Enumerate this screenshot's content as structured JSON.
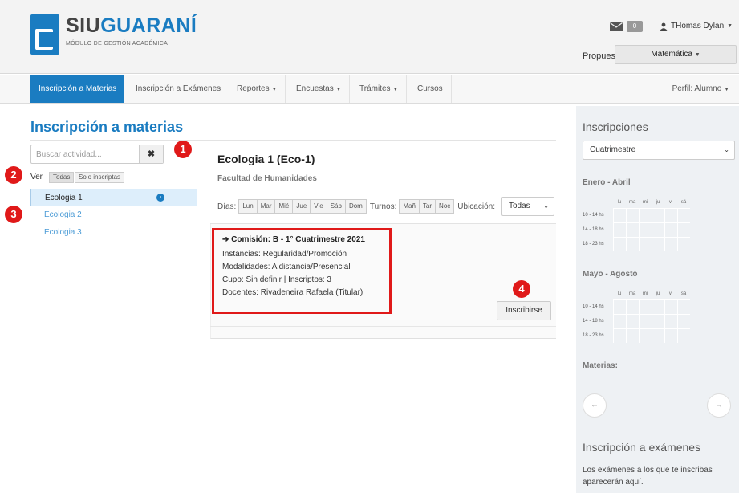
{
  "header": {
    "logo_siu": "SIU",
    "logo_guarani": "GUARANÍ",
    "logo_subtitle": "MÓDULO DE GESTIÓN ACADÉMICA",
    "mail_count": "0",
    "user_name": "THomas Dylan",
    "propuesta_label": "Propuesta:",
    "propuesta_value": "Matemática"
  },
  "nav": {
    "items": [
      {
        "label": "Inscripción a Materias",
        "active": true
      },
      {
        "label": "Inscripción a Exámenes"
      },
      {
        "label": "Reportes"
      },
      {
        "label": "Encuestas"
      },
      {
        "label": "Trámites"
      },
      {
        "label": "Cursos"
      }
    ],
    "perfil": "Perfil: Alumno"
  },
  "main": {
    "title": "Inscripción a materias",
    "search_placeholder": "Buscar actividad...",
    "clear_symbol": "✖",
    "ver_label": "Ver",
    "ver_options": [
      "Todas",
      "Solo inscriptas"
    ],
    "activities": [
      "Ecologia 1",
      "Ecologia 2",
      "Ecologia 3"
    ],
    "markers": [
      "1",
      "2",
      "3",
      "4"
    ]
  },
  "materia": {
    "title": "Ecologia 1 (Eco-1)",
    "facultad": "Facultad de Humanidades",
    "dias_label": "Días:",
    "dias": [
      "Lun",
      "Mar",
      "Mié",
      "Jue",
      "Vie",
      "Sáb",
      "Dom"
    ],
    "turnos_label": "Turnos:",
    "turnos": [
      "Mañ",
      "Tar",
      "Noc"
    ],
    "ubicacion_label": "Ubicación:",
    "ubicacion_value": "Todas",
    "commission": {
      "title": "➔ Comisión: B - 1° Cuatrimestre 2021",
      "instancias": "Instancias: Regularidad/Promoción",
      "modalidades": "Modalidades: A distancia/Presencial",
      "cupo": "Cupo: Sin definir | Inscriptos: 3",
      "docentes": "Docentes: Rivadeneira Rafaela (Titular)"
    },
    "inscribirse_label": "Inscribirse"
  },
  "sidebar": {
    "inscripciones_title": "Inscripciones",
    "periodo_value": "Cuatrimestre",
    "sem1_title": "Enero - Abril",
    "sem2_title": "Mayo - Agosto",
    "days": [
      "lu",
      "ma",
      "mi",
      "ju",
      "vi",
      "sá"
    ],
    "slots": [
      "10 - 14 hs",
      "14 - 18 hs",
      "18 - 23 hs"
    ],
    "materias_label": "Materias:",
    "prev_symbol": "←",
    "next_symbol": "→",
    "examenes_title": "Inscripción a exámenes",
    "examenes_text": "Los exámenes a los que te inscribas aparecerán aquí."
  },
  "colors": {
    "accent": "#1a7cc1",
    "marker": "#e01919",
    "sidebar_bg": "#eef1f4"
  }
}
